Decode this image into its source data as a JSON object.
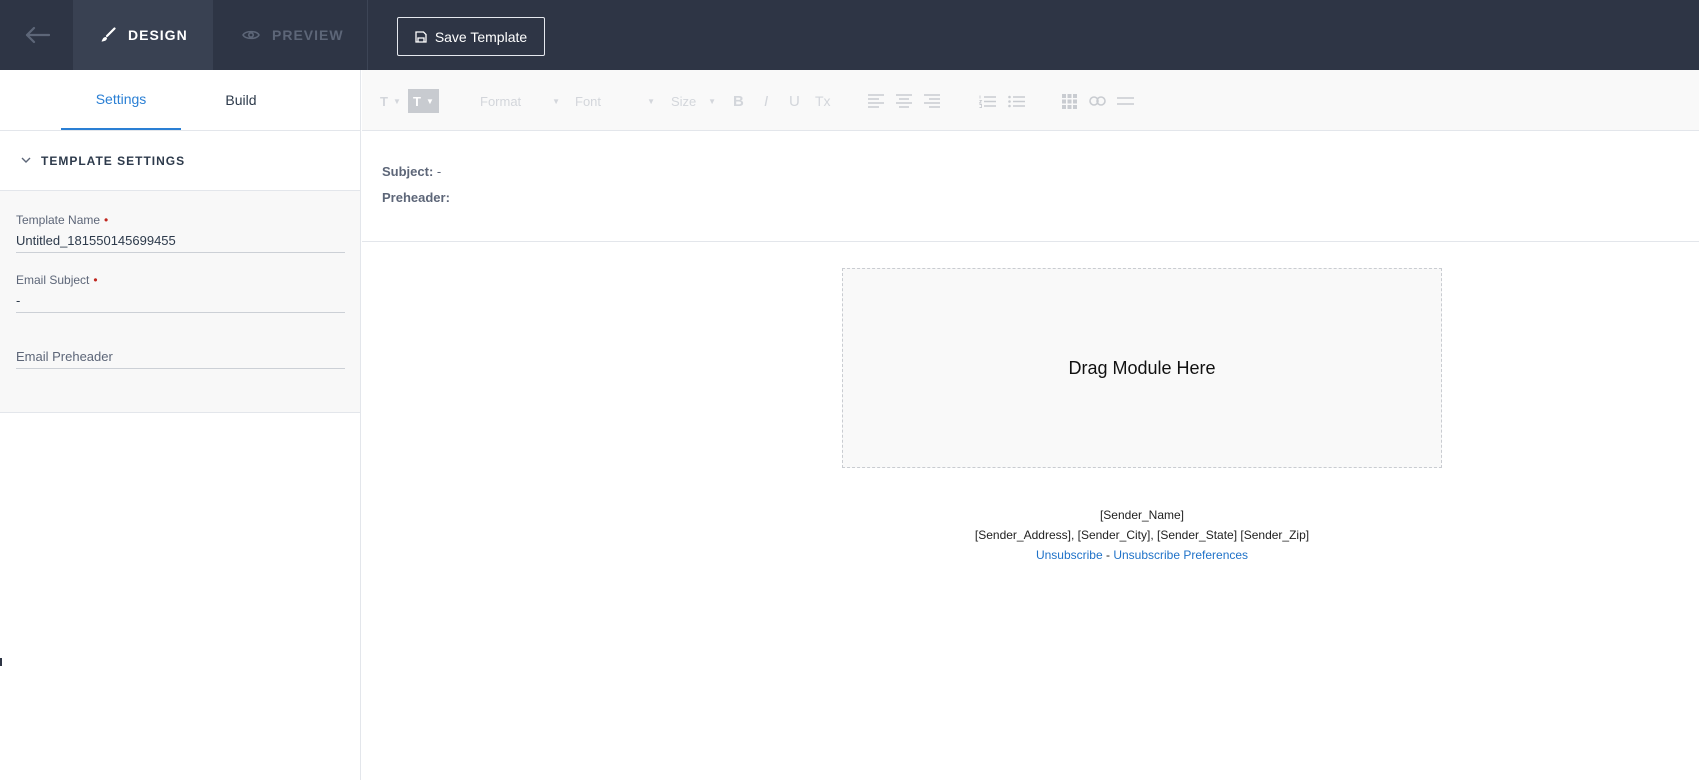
{
  "topbar": {
    "design_label": "DESIGN",
    "preview_label": "PREVIEW",
    "save_label": "Save Template"
  },
  "left_panel": {
    "tabs": [
      {
        "label": "Settings",
        "active": true
      },
      {
        "label": "Build",
        "active": false
      }
    ],
    "section_title": "TEMPLATE SETTINGS",
    "fields": {
      "template_name": {
        "label": "Template Name",
        "value": "Untitled_181550145699455",
        "required": true
      },
      "email_subject": {
        "label": "Email Subject",
        "value": "-",
        "required": true
      },
      "email_preheader": {
        "placeholder": "Email Preheader",
        "value": ""
      }
    }
  },
  "toolbar": {
    "text_style": "T",
    "text_bg": "T",
    "format": "Format",
    "font": "Font",
    "size": "Size",
    "bold": "B",
    "italic": "I",
    "underline": "U",
    "clear_format": "Tx"
  },
  "email_meta": {
    "subject_label": "Subject:",
    "subject_value": "-",
    "preheader_label": "Preheader:",
    "preheader_value": ""
  },
  "canvas": {
    "dropzone_text": "Drag Module Here",
    "footer": {
      "sender_name": "[Sender_Name]",
      "sender_address": "[Sender_Address], [Sender_City], [Sender_State] [Sender_Zip]",
      "unsubscribe": "Unsubscribe",
      "separator": "-",
      "unsubscribe_prefs": "Unsubscribe Preferences"
    }
  },
  "colors": {
    "topbar_bg": "#2e3545",
    "accent": "#2a7fd4",
    "required": "#c0271f",
    "link": "#1f72c8"
  }
}
